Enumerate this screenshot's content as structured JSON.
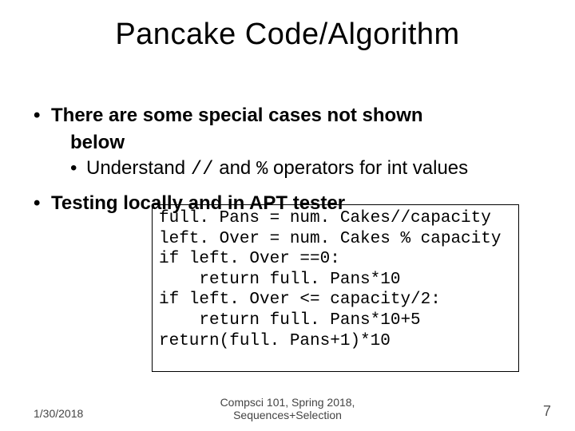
{
  "title": "Pancake Code/Algorithm",
  "bullets": {
    "b1_line1": "There are some special cases not shown",
    "b1_line2": "below",
    "b2_pre": "Understand ",
    "b2_code1": "//",
    "b2_mid": " and ",
    "b2_code2": "%",
    "b2_post": " operators for int values",
    "b3": "Testing locally and in APT tester"
  },
  "code": {
    "l1": "full. Pans = num. Cakes//capacity",
    "l2": "left. Over = num. Cakes % capacity",
    "l3": "if left. Over ==0:",
    "l4": "    return full. Pans*10",
    "l5": "if left. Over <= capacity/2:",
    "l6": "    return full. Pans*10+5",
    "l7": "return(full. Pans+1)*10"
  },
  "footer": {
    "date": "1/30/2018",
    "center_l1": "Compsci 101, Spring 2018,",
    "center_l2": "Sequences+Selection",
    "page": "7"
  }
}
